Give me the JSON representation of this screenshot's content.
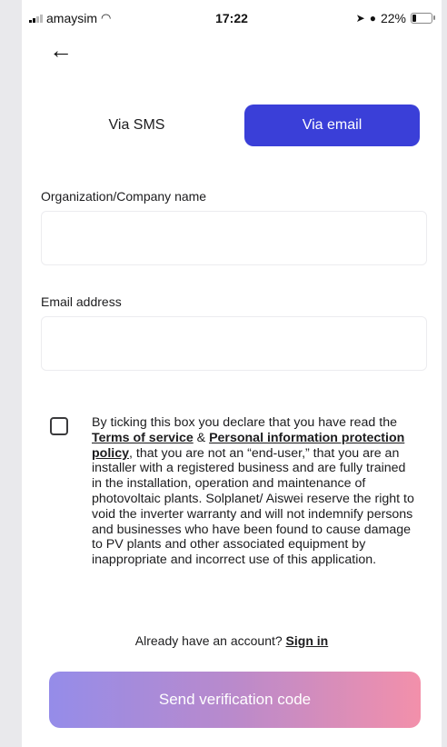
{
  "status_bar": {
    "carrier": "amaysim",
    "time": "17:22",
    "battery": "22%",
    "battery_level": 0.22
  },
  "tabs": {
    "sms_label": "Via SMS",
    "email_label": "Via email",
    "active": "email"
  },
  "form": {
    "org_label": "Organization/Company name",
    "org_value": "",
    "email_label": "Email address",
    "email_value": ""
  },
  "terms": {
    "checked": false,
    "intro": "By ticking this box you declare that you have read the ",
    "tos_link": "Terms of service",
    "amp": " & ",
    "privacy_link": "Personal information protection policy",
    "body": ", that you are not an “end-user,” that you are an installer with a registered business and are fully trained in the installation, operation and maintenance of photovoltaic plants. Solplanet/ Aiswei reserve the right to void the inverter warranty and will not indemnify persons and businesses who have been found to cause damage to PV plants and other associated equipment by inappropriate and incorrect use of this application."
  },
  "account": {
    "prompt": "Already have an account? ",
    "sign_in": "Sign in"
  },
  "send_button": "Send verification code",
  "colors": {
    "accent": "#3a3fd8",
    "gradient_start": "#8f86e8",
    "gradient_end": "#f28aa6"
  }
}
